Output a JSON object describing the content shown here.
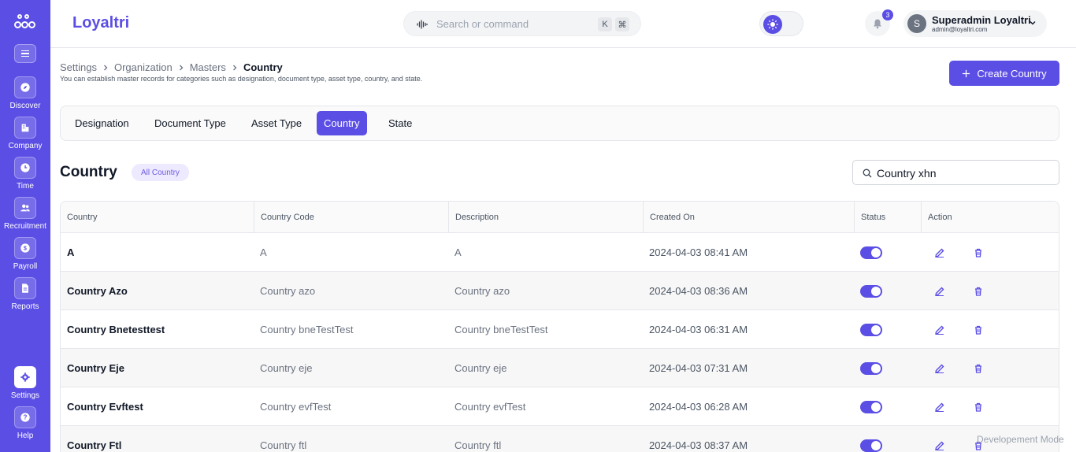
{
  "app": {
    "brand": "Loyaltri",
    "accent": "#5b4ee5"
  },
  "sidebar": {
    "items": [
      {
        "label": "Discover",
        "icon": "compass-icon"
      },
      {
        "label": "Company",
        "icon": "building-icon"
      },
      {
        "label": "Time",
        "icon": "clock-icon"
      },
      {
        "label": "Recruitment",
        "icon": "users-icon"
      },
      {
        "label": "Payroll",
        "icon": "dollar-icon"
      },
      {
        "label": "Reports",
        "icon": "file-icon"
      }
    ],
    "bottom": [
      {
        "label": "Settings",
        "icon": "gear-icon",
        "active": true
      },
      {
        "label": "Help",
        "icon": "help-icon"
      }
    ]
  },
  "topbar": {
    "search_placeholder": "Search or command",
    "kbd_k": "K",
    "kbd_cmd": "⌘",
    "notification_count": "3",
    "user": {
      "initial": "S",
      "name": "Superadmin Loyaltri",
      "email": "admin@loyaltri.com"
    }
  },
  "breadcrumb": [
    "Settings",
    "Organization",
    "Masters",
    "Country"
  ],
  "page": {
    "description": "You can establish master records for categories such as designation, document type, asset type, country, and state.",
    "create_button": "Create Country"
  },
  "tabs": [
    {
      "label": "Designation",
      "active": false
    },
    {
      "label": "Document Type",
      "active": false
    },
    {
      "label": "Asset Type",
      "active": false
    },
    {
      "label": "Country",
      "active": true
    },
    {
      "label": "State",
      "active": false
    }
  ],
  "section": {
    "title": "Country",
    "pill": "All Country",
    "search_value": "Country xhn"
  },
  "table": {
    "columns": [
      "Country",
      "Country Code",
      "Description",
      "Created On",
      "Status",
      "Action"
    ],
    "rows": [
      {
        "country": "A",
        "code": "A",
        "description": "A",
        "created": "2024-04-03 08:41 AM",
        "status": true
      },
      {
        "country": "Country Azo",
        "code": "Country azo",
        "description": "Country azo",
        "created": "2024-04-03 08:36 AM",
        "status": true
      },
      {
        "country": "Country Bnetesttest",
        "code": "Country bneTestTest",
        "description": "Country bneTestTest",
        "created": "2024-04-03 06:31 AM",
        "status": true
      },
      {
        "country": "Country Eje",
        "code": "Country eje",
        "description": "Country eje",
        "created": "2024-04-03 07:31 AM",
        "status": true
      },
      {
        "country": "Country Evftest",
        "code": "Country evfTest",
        "description": "Country evfTest",
        "created": "2024-04-03 06:28 AM",
        "status": true
      },
      {
        "country": "Country Ftl",
        "code": "Country ftl",
        "description": "Country ftl",
        "created": "2024-04-03 08:37 AM",
        "status": true
      }
    ]
  },
  "footer": {
    "dev_mode": "Developement Mode"
  }
}
